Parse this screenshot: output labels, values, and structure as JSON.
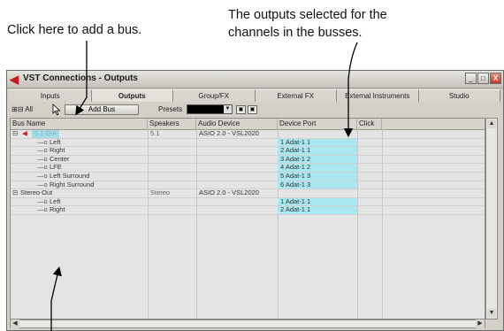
{
  "annotations": {
    "add_bus": "Click here to add a bus.",
    "outputs_line1": "The outputs selected for the",
    "outputs_line2": "channels in the busses."
  },
  "window": {
    "title": "VST Connections - Outputs",
    "buttons": {
      "minimize": "_",
      "maximize": "□",
      "close": "X"
    }
  },
  "tabs": [
    {
      "label": "Inputs",
      "active": false
    },
    {
      "label": "Outputs",
      "active": true
    },
    {
      "label": "Group/FX",
      "active": false
    },
    {
      "label": "External FX",
      "active": false
    },
    {
      "label": "External Instruments",
      "active": false
    },
    {
      "label": "Studio",
      "active": false
    }
  ],
  "toolbar": {
    "expand_all": "⊞⊟ All",
    "add_bus": "Add Bus",
    "presets_label": "Presets",
    "preset_arrow": "▼"
  },
  "table": {
    "headers": [
      "Bus Name",
      "Speakers",
      "Audio Device",
      "Device Port",
      "Click"
    ],
    "rows": [
      {
        "name": "5.1 Out",
        "bus": true,
        "speakers": "5.1",
        "device": "ASIO 2.0 - VSL2020",
        "port": ""
      },
      {
        "name": "Left",
        "bus": false,
        "speakers": "",
        "device": "",
        "port": "1 Adat-1 1"
      },
      {
        "name": "Right",
        "bus": false,
        "speakers": "",
        "device": "",
        "port": "2 Adat-1 1"
      },
      {
        "name": "Center",
        "bus": false,
        "speakers": "",
        "device": "",
        "port": "3 Adat-1 2"
      },
      {
        "name": "LFE",
        "bus": false,
        "speakers": "",
        "device": "",
        "port": "4 Adat-1 2"
      },
      {
        "name": "Left Surround",
        "bus": false,
        "speakers": "",
        "device": "",
        "port": "5 Adat-1 3"
      },
      {
        "name": "Right Surround",
        "bus": false,
        "speakers": "",
        "device": "",
        "port": "6 Adat-1 3"
      },
      {
        "name": "Stereo Out",
        "bus": true,
        "speakers": "Stereo",
        "device": "ASIO 2.0 - VSL2020",
        "port": ""
      },
      {
        "name": "Left",
        "bus": false,
        "speakers": "",
        "device": "",
        "port": "1 Adat-1 1"
      },
      {
        "name": "Right",
        "bus": false,
        "speakers": "",
        "device": "",
        "port": "2 Adat-1 1"
      }
    ]
  },
  "colors": {
    "port_fill": "#a9e8f0",
    "vst_logo": "#c41d1d",
    "bus_highlight": "#a8dce4"
  }
}
